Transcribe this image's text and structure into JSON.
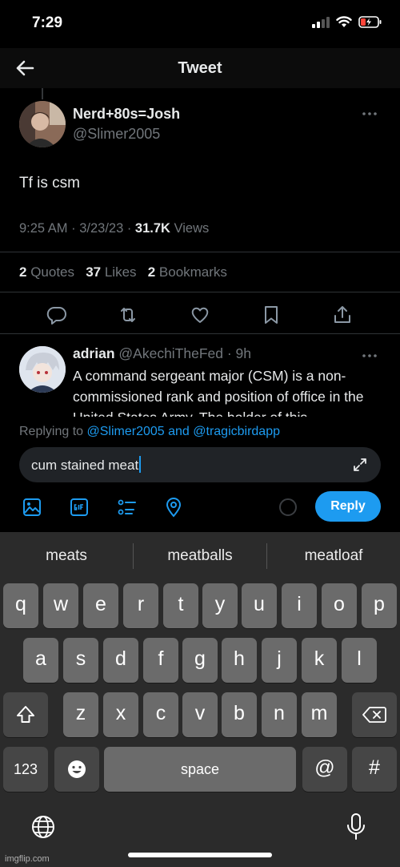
{
  "status_bar": {
    "time": "7:29"
  },
  "header": {
    "title": "Tweet"
  },
  "tweet": {
    "display_name": "Nerd+80s=Josh",
    "handle": "@Slimer2005",
    "text": "Tf is csm",
    "timestamp": "9:25 AM · 3/23/23 · ",
    "views_count": "31.7K",
    "views_label": " Views",
    "quotes_count": "2",
    "quotes_label": " Quotes",
    "likes_count": "37",
    "likes_label": " Likes",
    "bookmarks_count": "2",
    "bookmarks_label": " Bookmarks"
  },
  "reply": {
    "display_name": "adrian",
    "handle": " @AkechiTheFed",
    "time": " · 9h",
    "text": "A command sergeant major (CSM) is a non-commissioned rank and position of office in the United States Army. The holder of this"
  },
  "compose": {
    "replying_prefix": "Replying to ",
    "replying_users": "@Slimer2005 and @tragicbirdapp",
    "input_value": "cum stained meat",
    "reply_button": "Reply"
  },
  "keyboard": {
    "suggestions": [
      "meats",
      "meatballs",
      "meatloaf"
    ],
    "row1": [
      "q",
      "w",
      "e",
      "r",
      "t",
      "y",
      "u",
      "i",
      "o",
      "p"
    ],
    "row2": [
      "a",
      "s",
      "d",
      "f",
      "g",
      "h",
      "j",
      "k",
      "l"
    ],
    "row3": [
      "z",
      "x",
      "c",
      "v",
      "b",
      "n",
      "m"
    ],
    "numbers_key": "123",
    "space_key": "space",
    "at_key": "@",
    "hash_key": "#"
  },
  "watermark": "imgflip.com",
  "colors": {
    "accent": "#1d9bf0",
    "background": "#000000",
    "muted": "#71767b"
  }
}
